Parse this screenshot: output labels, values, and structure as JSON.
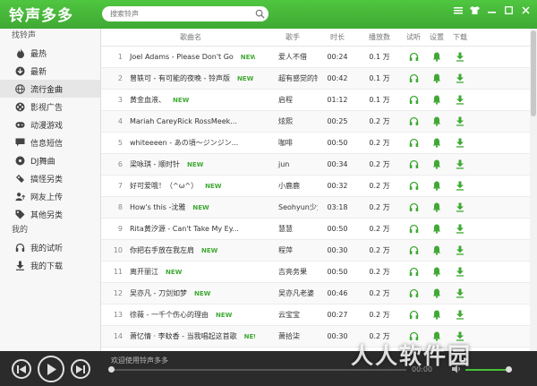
{
  "app": {
    "title": "铃声多多"
  },
  "search": {
    "placeholder": "搜索铃声"
  },
  "sidebar": {
    "section1_label": "找铃声",
    "section2_label": "我的",
    "items": [
      {
        "label": "最热",
        "icon": "flame-icon"
      },
      {
        "label": "最新",
        "icon": "new-icon"
      },
      {
        "label": "流行金曲",
        "icon": "globe-icon"
      },
      {
        "label": "影视广告",
        "icon": "film-icon"
      },
      {
        "label": "动漫游戏",
        "icon": "gamepad-icon"
      },
      {
        "label": "信息短信",
        "icon": "message-icon"
      },
      {
        "label": "DJ舞曲",
        "icon": "dj-icon"
      },
      {
        "label": "搞怪另类",
        "icon": "funny-icon"
      },
      {
        "label": "网友上传",
        "icon": "upload-user-icon"
      },
      {
        "label": "其他另类",
        "icon": "tag-icon"
      }
    ],
    "my_items": [
      {
        "label": "我的试听",
        "icon": "headphones-icon"
      },
      {
        "label": "我的下载",
        "icon": "download-icon"
      }
    ]
  },
  "table": {
    "headers": {
      "name": "歌曲名",
      "artist": "歌手",
      "duration": "时长",
      "plays": "播放数",
      "listen": "试听",
      "set": "设置",
      "download": "下载"
    },
    "rows": [
      {
        "no": "1",
        "name": "Joel Adams - Please Don't Go",
        "new": "NEW",
        "artist": "爱人不借",
        "duration": "00:24",
        "plays": "0.1 万"
      },
      {
        "no": "2",
        "name": "曾轶可 - 有可能的夜晚 - 铃声版",
        "new": "NEW",
        "artist": "超有感觉的铃声",
        "duration": "00:42",
        "plays": "0.1 万"
      },
      {
        "no": "3",
        "name": "黄金血液、",
        "new": "NEW",
        "artist": "启程",
        "duration": "01:12",
        "plays": "0.1 万"
      },
      {
        "no": "4",
        "name": "Mariah CareyRick RossMeek...",
        "new": "",
        "artist": "炫熙",
        "duration": "00:25",
        "plays": "0.2 万"
      },
      {
        "no": "5",
        "name": "whiteeeen - あの頃～ジンジン...",
        "new": "",
        "artist": "咖啡",
        "duration": "00:50",
        "plays": "0.2 万"
      },
      {
        "no": "6",
        "name": "梁咏琪 - 顺时针",
        "new": "NEW",
        "artist": "jun",
        "duration": "00:34",
        "plays": "0.2 万"
      },
      {
        "no": "7",
        "name": "好可爱哦！（^ω^）",
        "new": "NEW",
        "artist": "小鹿鹿",
        "duration": "00:32",
        "plays": "0.2 万"
      },
      {
        "no": "8",
        "name": "How's this -沈雅",
        "new": "NEW",
        "artist": "Seohyun少女...",
        "duration": "03:18",
        "plays": "0.2 万"
      },
      {
        "no": "9",
        "name": "Rita黄汐源 - Can't Take My Ey...",
        "new": "",
        "artist": "慧慧",
        "duration": "00:50",
        "plays": "0.2 万"
      },
      {
        "no": "10",
        "name": "你把右手放在我左肩",
        "new": "NEW",
        "artist": "程萍",
        "duration": "00:30",
        "plays": "0.2 万"
      },
      {
        "no": "11",
        "name": "离开丽江",
        "new": "NEW",
        "artist": "吉亮务果",
        "duration": "00:50",
        "plays": "0.2 万"
      },
      {
        "no": "12",
        "name": "吴亦凡 - 刀剑如梦",
        "new": "NEW",
        "artist": "吴亦凡老婆",
        "duration": "00:46",
        "plays": "0.2 万"
      },
      {
        "no": "13",
        "name": "徐薇 - 一千个伤心的理由",
        "new": "NEW",
        "artist": "云宝宝",
        "duration": "00:27",
        "plays": "0.2 万"
      },
      {
        "no": "14",
        "name": "萧忆情 · 李蚊香 - 当我唱起这首歌",
        "new": "NEW",
        "artist": "萧拾柒",
        "duration": "00:30",
        "plays": "0.2 万"
      }
    ]
  },
  "player": {
    "now_playing": "欢迎使用铃声多多",
    "time": "00:00",
    "progress": 0,
    "volume": 0.92
  },
  "watermark": "人人软件园",
  "colors": {
    "brand_green": "#3fa934",
    "player_bg": "#2b2b2b"
  }
}
